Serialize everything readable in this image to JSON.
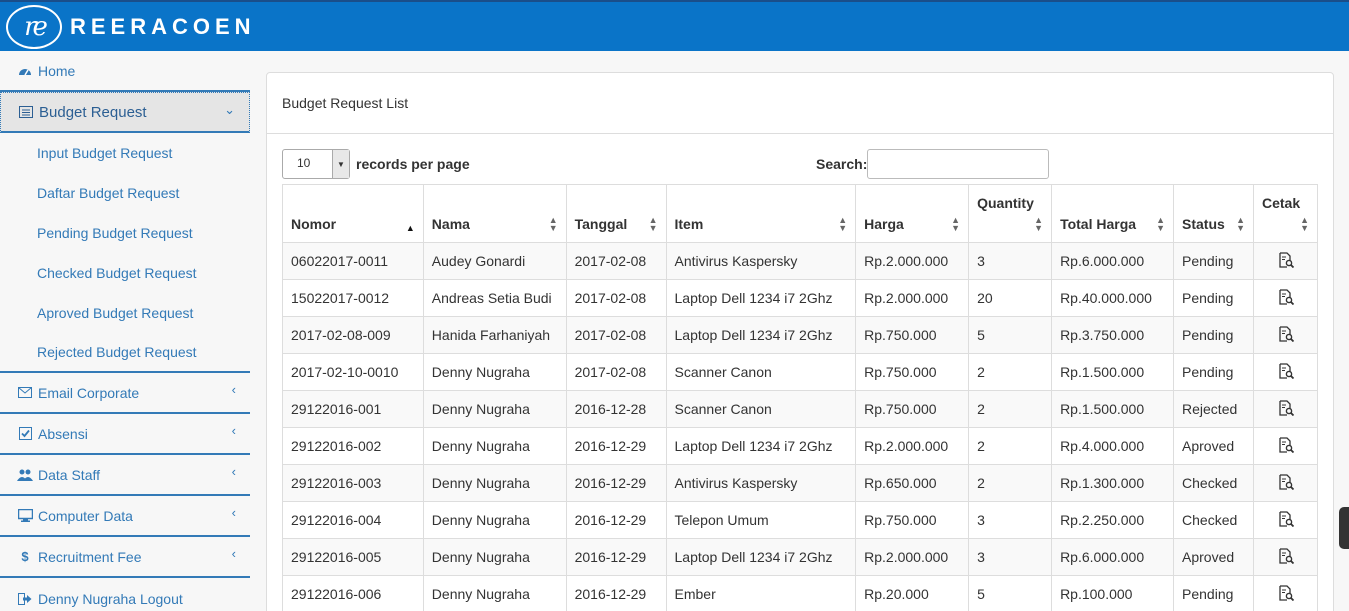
{
  "header": {
    "logo_mark": "re",
    "brand": "REERACOEN"
  },
  "sidebar": {
    "items": [
      {
        "label": "Home",
        "icon": "dashboard-icon"
      },
      {
        "label": "Budget Request",
        "icon": "list-icon",
        "expanded": true
      },
      {
        "label": "Email Corporate",
        "icon": "envelope-icon"
      },
      {
        "label": "Absensi",
        "icon": "check-square-icon"
      },
      {
        "label": "Data Staff",
        "icon": "users-icon"
      },
      {
        "label": "Computer Data",
        "icon": "desktop-icon"
      },
      {
        "label": "Recruitment Fee",
        "icon": "dollar-icon"
      },
      {
        "label": "Denny Nugraha Logout",
        "icon": "sign-out-icon"
      }
    ],
    "subitems": [
      "Input Budget Request",
      "Daftar Budget Request",
      "Pending Budget Request",
      "Checked Budget Request",
      "Aproved Budget Request",
      "Rejected Budget Request"
    ]
  },
  "panel": {
    "title": "Budget Request List"
  },
  "controls": {
    "page_length": "10",
    "page_length_label": "records per page",
    "search_label": "Search:",
    "search_value": ""
  },
  "table": {
    "columns": [
      "Nomor",
      "Nama",
      "Tanggal",
      "Item",
      "Harga",
      "Quantity",
      "Total Harga",
      "Status",
      "Cetak"
    ],
    "rows": [
      [
        "06022017-0011",
        "Audey Gonardi",
        "2017-02-08",
        "Antivirus Kaspersky",
        "Rp.2.000.000",
        "3",
        "Rp.6.000.000",
        "Pending"
      ],
      [
        "15022017-0012",
        "Andreas Setia Budi",
        "2017-02-08",
        "Laptop Dell 1234 i7 2Ghz",
        "Rp.2.000.000",
        "20",
        "Rp.40.000.000",
        "Pending"
      ],
      [
        "2017-02-08-009",
        "Hanida Farhaniyah",
        "2017-02-08",
        "Laptop Dell 1234 i7 2Ghz",
        "Rp.750.000",
        "5",
        "Rp.3.750.000",
        "Pending"
      ],
      [
        "2017-02-10-0010",
        "Denny Nugraha",
        "2017-02-08",
        "Scanner Canon",
        "Rp.750.000",
        "2",
        "Rp.1.500.000",
        "Pending"
      ],
      [
        "29122016-001",
        "Denny Nugraha",
        "2016-12-28",
        "Scanner Canon",
        "Rp.750.000",
        "2",
        "Rp.1.500.000",
        "Rejected"
      ],
      [
        "29122016-002",
        "Denny Nugraha",
        "2016-12-29",
        "Laptop Dell 1234 i7 2Ghz",
        "Rp.2.000.000",
        "2",
        "Rp.4.000.000",
        "Aproved"
      ],
      [
        "29122016-003",
        "Denny Nugraha",
        "2016-12-29",
        "Antivirus Kaspersky",
        "Rp.650.000",
        "2",
        "Rp.1.300.000",
        "Checked"
      ],
      [
        "29122016-004",
        "Denny Nugraha",
        "2016-12-29",
        "Telepon Umum",
        "Rp.750.000",
        "3",
        "Rp.2.250.000",
        "Checked"
      ],
      [
        "29122016-005",
        "Denny Nugraha",
        "2016-12-29",
        "Laptop Dell 1234 i7 2Ghz",
        "Rp.2.000.000",
        "3",
        "Rp.6.000.000",
        "Aproved"
      ],
      [
        "29122016-006",
        "Denny Nugraha",
        "2016-12-29",
        "Ember",
        "Rp.20.000",
        "5",
        "Rp.100.000",
        "Pending"
      ]
    ]
  },
  "colors": {
    "topbar": "#0a74c8",
    "link": "#337ab7",
    "active_bg": "#e5e5e5"
  }
}
